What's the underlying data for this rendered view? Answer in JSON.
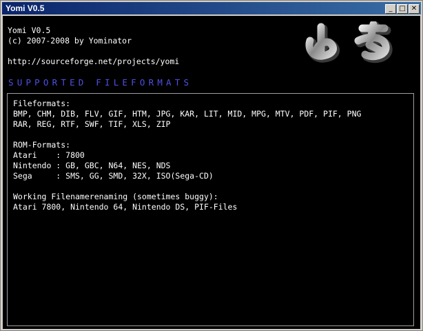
{
  "window": {
    "title": "Yomi V0.5",
    "minimize": "_",
    "maximize": "□",
    "close": "✕"
  },
  "header": {
    "line1": "Yomi V0.5",
    "line2": "(c) 2007-2008 by Yominator",
    "url": "http://sourceforge.net/projects/yomi"
  },
  "logo_icon": "yomi-kana-logo-icon",
  "section_title": "SUPPORTED FILEFORMATS",
  "colors": {
    "heading": "#5050e8",
    "titlebar": "#0a246a"
  },
  "panel": {
    "fileformats_label": "Fileformats:",
    "fileformats_line1": "BMP, CHM, DIB, FLV, GIF, HTM, JPG, KAR, LIT, MID, MPG, MTV, PDF, PIF, PNG",
    "fileformats_line2": "RAR, REG, RTF, SWF, TIF, XLS, ZIP",
    "rom_label": "ROM-Formats:",
    "rom_lines": [
      "Atari    : 7800",
      "Nintendo : GB, GBC, N64, NES, NDS",
      "Sega     : SMS, GG, SMD, 32X, ISO(Sega-CD)"
    ],
    "renaming_label": "Working Filenamerenaming (sometimes buggy):",
    "renaming_line": "Atari 7800, Nintendo 64, Nintendo DS, PIF-Files"
  }
}
